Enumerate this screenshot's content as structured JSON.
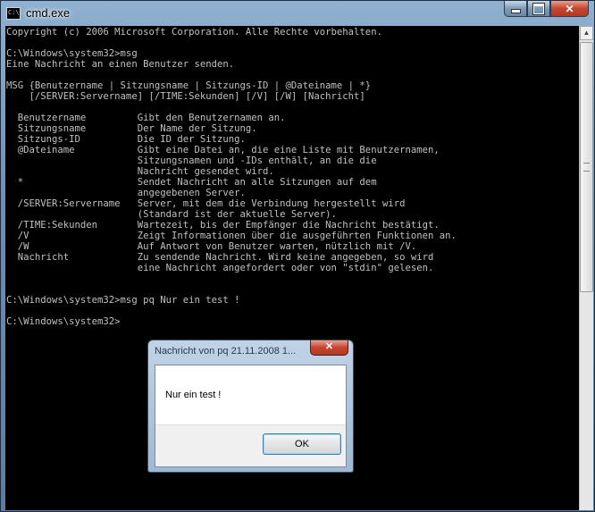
{
  "window": {
    "title": "cmd.exe",
    "icon_name": "console-icon",
    "icon_text": "C:\\",
    "minimize_icon": "minimize-icon",
    "maximize_icon": "maximize-icon",
    "close_glyph": "✕"
  },
  "console": {
    "lines": [
      "Copyright (c) 2006 Microsoft Corporation. Alle Rechte vorbehalten.",
      "",
      "C:\\Windows\\system32>msg",
      "Eine Nachricht an einen Benutzer senden.",
      "",
      "MSG {Benutzername | Sitzungsname | Sitzungs-ID | @Dateiname | *}",
      "    [/SERVER:Servername] [/TIME:Sekunden] [/V] [/W] [Nachricht]",
      "",
      "  Benutzername         Gibt den Benutzernamen an.",
      "  Sitzungsname         Der Name der Sitzung.",
      "  Sitzungs-ID          Die ID der Sitzung.",
      "  @Dateiname           Gibt eine Datei an, die eine Liste mit Benutzernamen,",
      "                       Sitzungsnamen und -IDs enthält, an die die",
      "                       Nachricht gesendet wird.",
      "  *                    Sendet Nachricht an alle Sitzungen auf dem",
      "                       angegebenen Server.",
      "  /SERVER:Servername   Server, mit dem die Verbindung hergestellt wird",
      "                       (Standard ist der aktuelle Server).",
      "  /TIME:Sekunden       Wartezeit, bis der Empfänger die Nachricht bestätigt.",
      "  /V                   Zeigt Informationen über die ausgeführten Funktionen an.",
      "  /W                   Auf Antwort von Benutzer warten, nützlich mit /V.",
      "  Nachricht            Zu sendende Nachricht. Wird keine angegeben, so wird",
      "                       eine Nachricht angefordert oder von \"stdin\" gelesen.",
      "",
      "",
      "C:\\Windows\\system32>msg pq Nur ein test !",
      "",
      "C:\\Windows\\system32>"
    ]
  },
  "scrollbar": {
    "up_arrow": "▲"
  },
  "dialog": {
    "title": "Nachricht von pq 21.11.2008 1...",
    "close_glyph": "✕",
    "message": "Nur ein test !",
    "ok_label": "OK"
  },
  "colors": {
    "console_bg": "#000000",
    "console_fg": "#c0c0c0",
    "close_red": "#c7452f"
  }
}
